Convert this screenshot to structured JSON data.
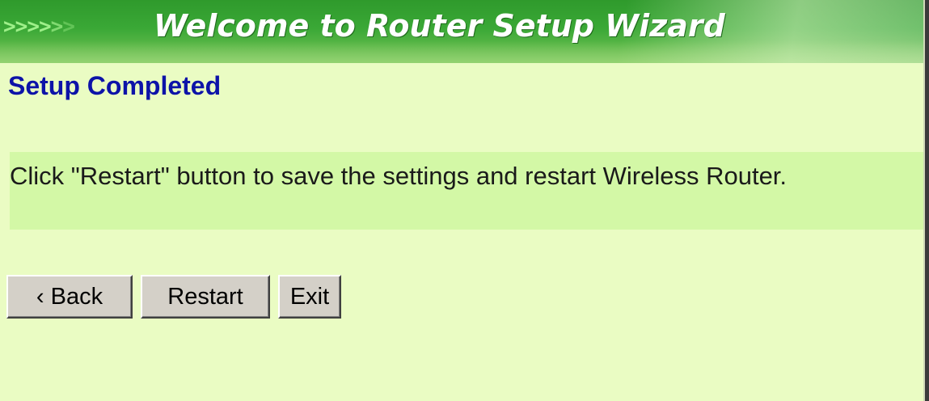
{
  "banner": {
    "arrows": [
      ">",
      ">",
      ">",
      ">",
      ">",
      ">"
    ],
    "title": "Welcome to Router Setup Wizard"
  },
  "page": {
    "heading": "Setup Completed",
    "message": "Click \"Restart\" button to save the settings and restart Wireless Router."
  },
  "buttons": {
    "back_label": "‹ Back",
    "restart_label": "Restart",
    "exit_label": "Exit"
  },
  "colors": {
    "banner_green": "#3aa836",
    "background": "#eafcc3",
    "message_band": "#d3f8a6",
    "heading_blue": "#0d13a8",
    "button_face": "#d4d0c8"
  }
}
